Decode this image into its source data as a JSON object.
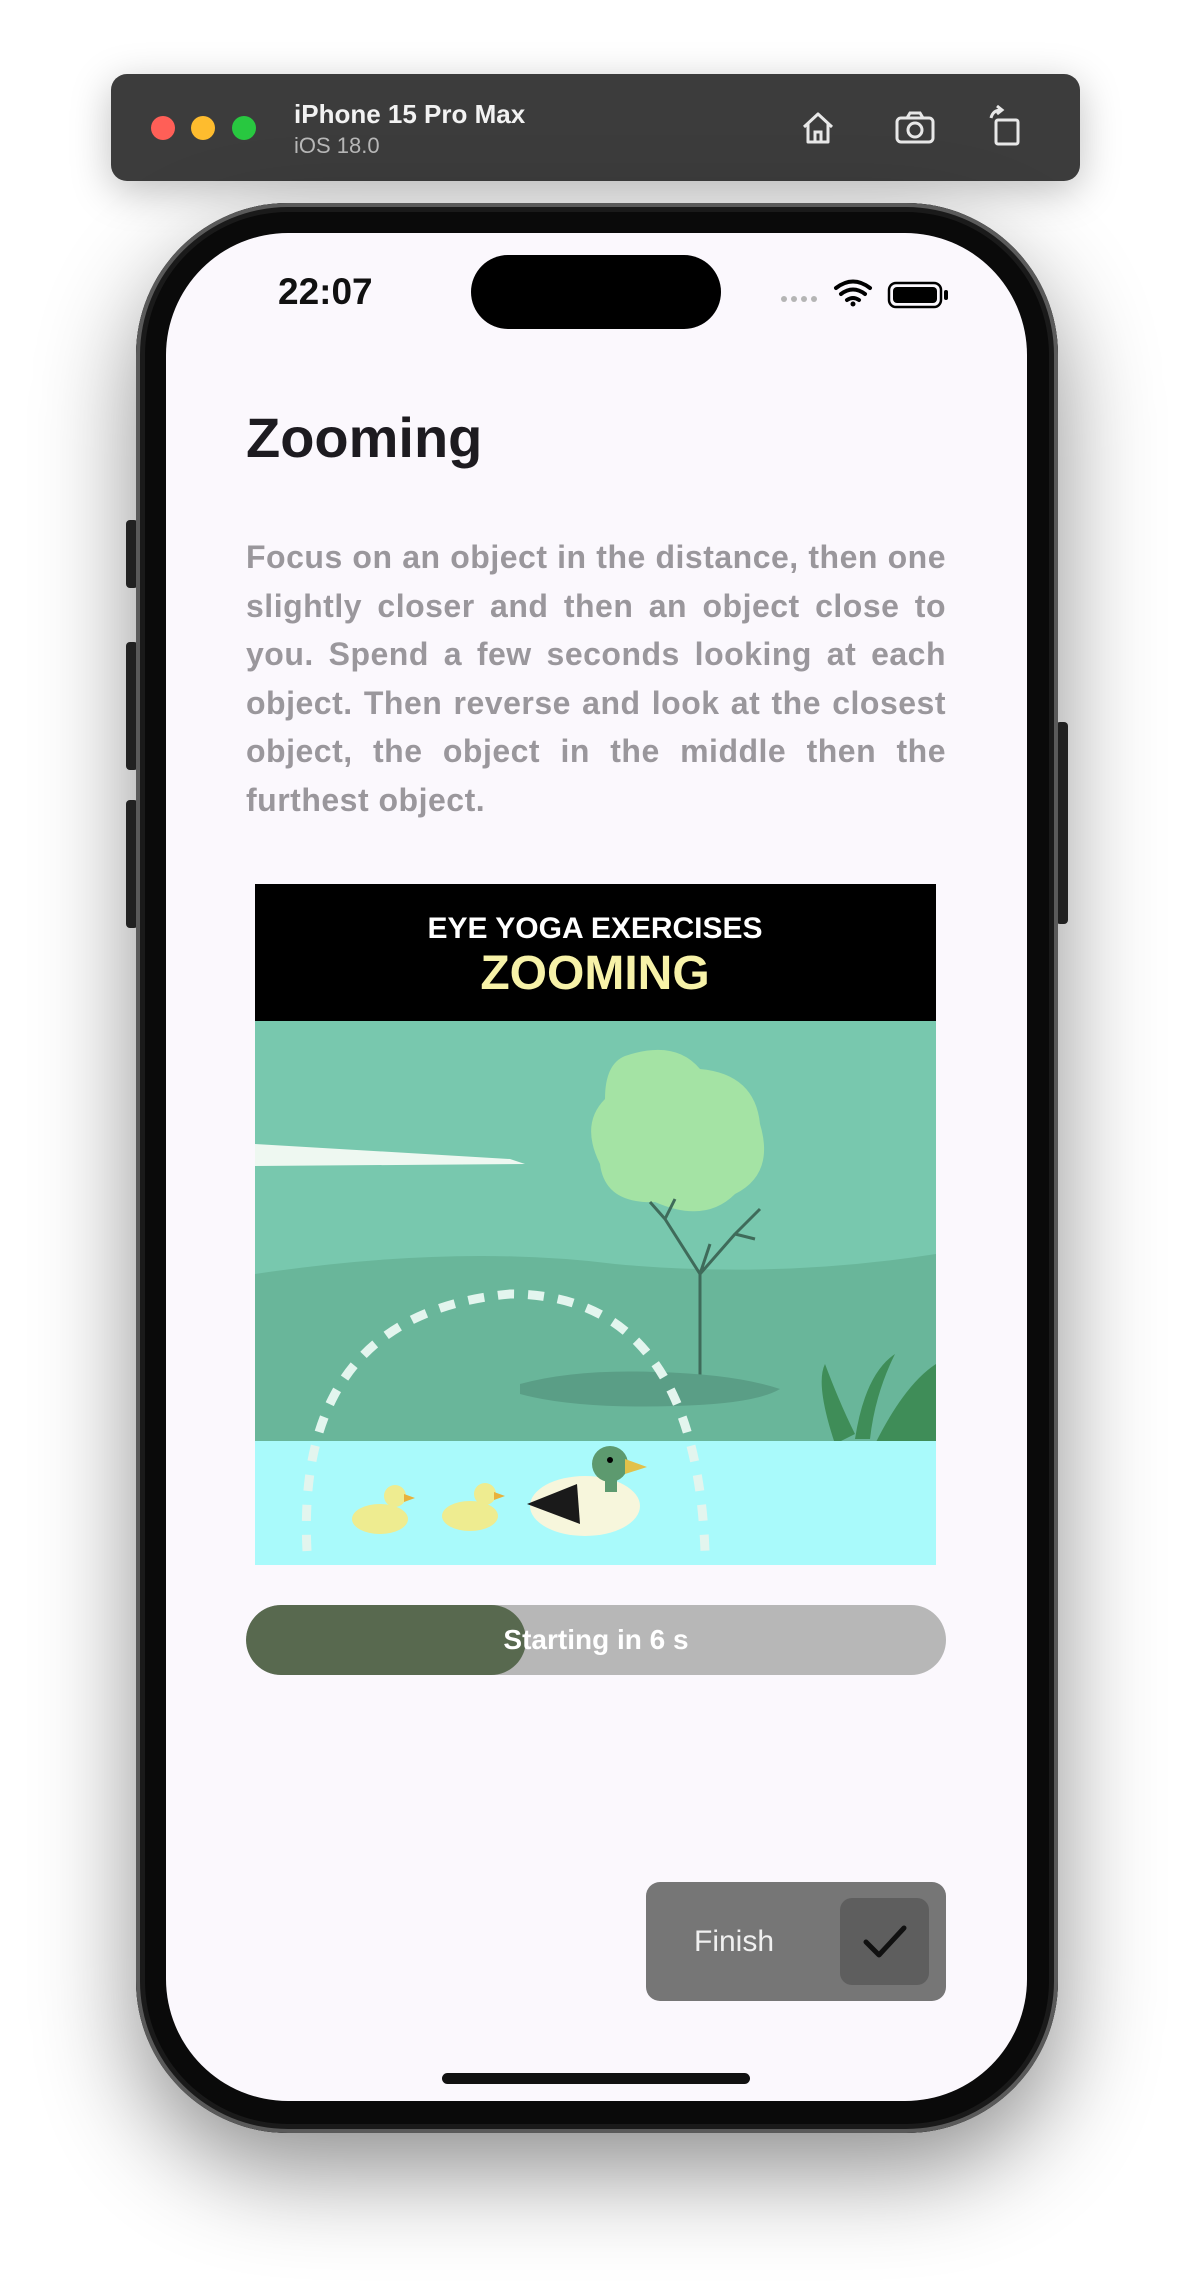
{
  "simulator": {
    "device_name": "iPhone 15 Pro Max",
    "os_version": "iOS 18.0",
    "icons": [
      "home-icon",
      "screenshot-icon",
      "rotate-icon"
    ]
  },
  "status_bar": {
    "time": "22:07",
    "icons": [
      "cellular-icon",
      "wifi-icon",
      "battery-icon"
    ]
  },
  "exercise": {
    "title": "Zooming",
    "description": "Focus on an object in the distance, then one slightly closer and then an object close to you. Spend a few seconds looking at each object. Then reverse and look at the closest object, the object in the middle then the furthest object.",
    "image": {
      "banner_top": "EYE YOGA EXERCISES",
      "banner_main": "ZOOMING"
    }
  },
  "progress": {
    "label": "Starting in 6 s",
    "fraction": 0.4,
    "fill_color": "#58694f",
    "track_color": "#b7b7b7"
  },
  "finish": {
    "label": "Finish",
    "icon": "checkmark-icon"
  }
}
